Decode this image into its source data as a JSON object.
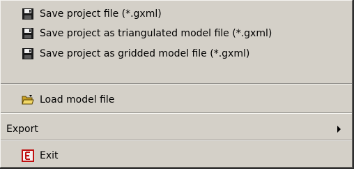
{
  "menu": {
    "items": [
      {
        "label": "Save project file (*.gxml)",
        "icon": "floppy-disk-icon"
      },
      {
        "label": "Save project as triangulated model file  (*.gxml)",
        "icon": "floppy-disk-icon"
      },
      {
        "label": "Save project as gridded model file  (*.gxml)",
        "icon": "floppy-disk-icon"
      },
      {
        "label": "Load model file",
        "icon": "open-folder-icon"
      },
      {
        "label": "Export",
        "icon": "submenu-arrow-icon"
      },
      {
        "label": "Exit",
        "icon": "exit-icon"
      }
    ]
  },
  "colors": {
    "menu_background": "#d4d0c8",
    "exit_icon_red": "#c01010",
    "folder_yellow": "#e8c84a"
  }
}
